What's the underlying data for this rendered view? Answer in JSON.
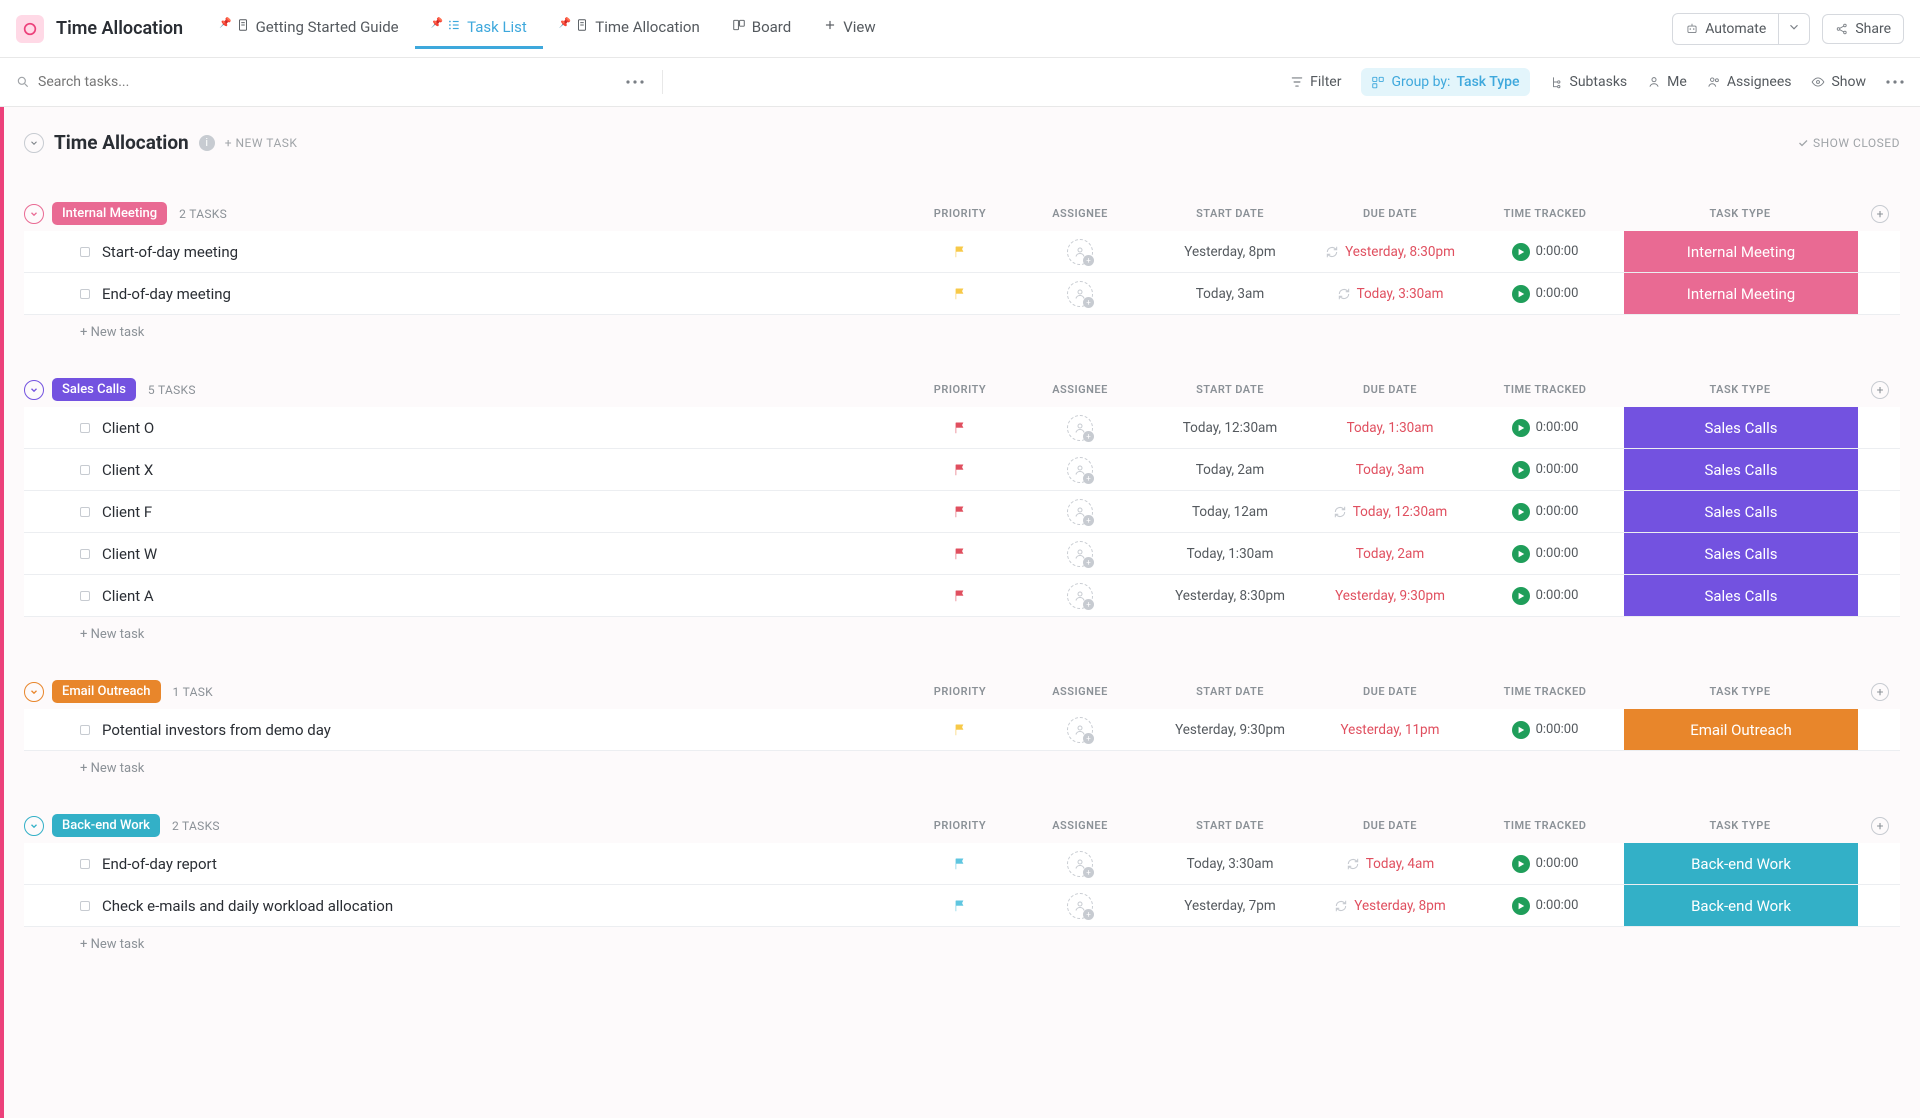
{
  "header": {
    "title": "Time Allocation",
    "tabs": [
      {
        "label": "Getting Started Guide",
        "icon": "doc",
        "pinned": true
      },
      {
        "label": "Task List",
        "icon": "list",
        "pinned": true,
        "active": true
      },
      {
        "label": "Time Allocation",
        "icon": "doc",
        "pinned": true
      },
      {
        "label": "Board",
        "icon": "board"
      },
      {
        "label": "View",
        "icon": "plus"
      }
    ],
    "automate": "Automate",
    "share": "Share"
  },
  "toolbar": {
    "search_placeholder": "Search tasks...",
    "filter": "Filter",
    "group_by_label": "Group by:",
    "group_by_value": "Task Type",
    "subtasks": "Subtasks",
    "me": "Me",
    "assignees": "Assignees",
    "show": "Show"
  },
  "list": {
    "title": "Time Allocation",
    "new_task": "+ NEW TASK",
    "show_closed": "SHOW CLOSED",
    "new_task_row": "+ New task",
    "columns": {
      "priority": "PRIORITY",
      "assignee": "ASSIGNEE",
      "start_date": "START DATE",
      "due_date": "DUE DATE",
      "time_tracked": "TIME TRACKED",
      "task_type": "TASK TYPE"
    }
  },
  "groups": [
    {
      "name": "Internal Meeting",
      "count_label": "2 TASKS",
      "color": "#e96a93",
      "caret_color": "#e96a93",
      "tasks": [
        {
          "name": "Start-of-day meeting",
          "flag": "#f7c948",
          "start": "Yesterday, 8pm",
          "due": "Yesterday, 8:30pm",
          "due_red": true,
          "recurring": true,
          "time": "0:00:00",
          "type_label": "Internal Meeting",
          "type_color": "#e96a93"
        },
        {
          "name": "End-of-day meeting",
          "flag": "#f7c948",
          "start": "Today, 3am",
          "due": "Today, 3:30am",
          "due_red": true,
          "recurring": true,
          "time": "0:00:00",
          "type_label": "Internal Meeting",
          "type_color": "#e96a93"
        }
      ]
    },
    {
      "name": "Sales Calls",
      "count_label": "5 TASKS",
      "color": "#7352e0",
      "caret_color": "#7352e0",
      "tasks": [
        {
          "name": "Client O",
          "flag": "#e04f5f",
          "start": "Today, 12:30am",
          "due": "Today, 1:30am",
          "due_red": true,
          "time": "0:00:00",
          "type_label": "Sales Calls",
          "type_color": "#7352e0"
        },
        {
          "name": "Client X",
          "flag": "#e04f5f",
          "start": "Today, 2am",
          "due": "Today, 3am",
          "due_red": true,
          "time": "0:00:00",
          "type_label": "Sales Calls",
          "type_color": "#7352e0"
        },
        {
          "name": "Client F",
          "flag": "#e04f5f",
          "start": "Today, 12am",
          "due": "Today, 12:30am",
          "due_red": true,
          "recurring": true,
          "time": "0:00:00",
          "type_label": "Sales Calls",
          "type_color": "#7352e0"
        },
        {
          "name": "Client W",
          "flag": "#e04f5f",
          "start": "Today, 1:30am",
          "due": "Today, 2am",
          "due_red": true,
          "time": "0:00:00",
          "type_label": "Sales Calls",
          "type_color": "#7352e0"
        },
        {
          "name": "Client A",
          "flag": "#e04f5f",
          "start": "Yesterday, 8:30pm",
          "due": "Yesterday, 9:30pm",
          "due_red": true,
          "time": "0:00:00",
          "type_label": "Sales Calls",
          "type_color": "#7352e0"
        }
      ]
    },
    {
      "name": "Email Outreach",
      "count_label": "1 TASK",
      "color": "#e8862b",
      "caret_color": "#e8862b",
      "tasks": [
        {
          "name": "Potential investors from demo day",
          "flag": "#f7c948",
          "start": "Yesterday, 9:30pm",
          "due": "Yesterday, 11pm",
          "due_red": true,
          "time": "0:00:00",
          "type_label": "Email Outreach",
          "type_color": "#e8862b"
        }
      ]
    },
    {
      "name": "Back-end Work",
      "count_label": "2 TASKS",
      "color": "#33b0c7",
      "caret_color": "#33b0c7",
      "tasks": [
        {
          "name": "End-of-day report",
          "flag": "#5fc6e0",
          "start": "Today, 3:30am",
          "due": "Today, 4am",
          "due_red": true,
          "recurring": true,
          "time": "0:00:00",
          "type_label": "Back-end Work",
          "type_color": "#33b0c7"
        },
        {
          "name": "Check e-mails and daily workload allocation",
          "flag": "#5fc6e0",
          "start": "Yesterday, 7pm",
          "due": "Yesterday, 8pm",
          "due_red": true,
          "recurring": true,
          "time": "0:00:00",
          "type_label": "Back-end Work",
          "type_color": "#33b0c7"
        }
      ]
    }
  ]
}
